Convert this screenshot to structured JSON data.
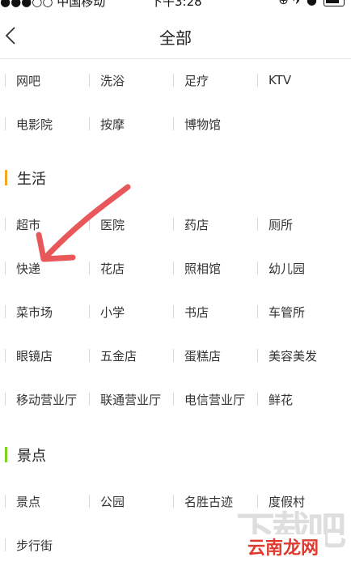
{
  "status_bar": {
    "carrier": "●●●○○ 中国移动",
    "time": "下午3:28",
    "right_icons": "⊕ ✈ ●"
  },
  "nav": {
    "back_icon": "chevron-left-icon",
    "title": "全部"
  },
  "top_rows": [
    [
      "网吧",
      "洗浴",
      "足疗",
      "KTV"
    ],
    [
      "电影院",
      "按摩",
      "博物馆"
    ]
  ],
  "sections": [
    {
      "title": "生活",
      "accent_color": "#f5a623",
      "rows": [
        [
          "超市",
          "医院",
          "药店",
          "厕所"
        ],
        [
          "快递",
          "花店",
          "照相馆",
          "幼儿园"
        ],
        [
          "菜市场",
          "小学",
          "书店",
          "车管所"
        ],
        [
          "眼镜店",
          "五金店",
          "蛋糕店",
          "美容美发"
        ],
        [
          "移动营业厅",
          "联通营业厅",
          "电信营业厅",
          "鲜花"
        ]
      ]
    },
    {
      "title": "景点",
      "accent_color": "#7ed321",
      "rows": [
        [
          "景点",
          "公园",
          "名胜古迹",
          "度假村"
        ],
        [
          "步行街"
        ]
      ]
    }
  ],
  "annotation_arrow_color": "#e8585a",
  "watermark": {
    "big": "下载吧",
    "small": "云南龙网"
  }
}
